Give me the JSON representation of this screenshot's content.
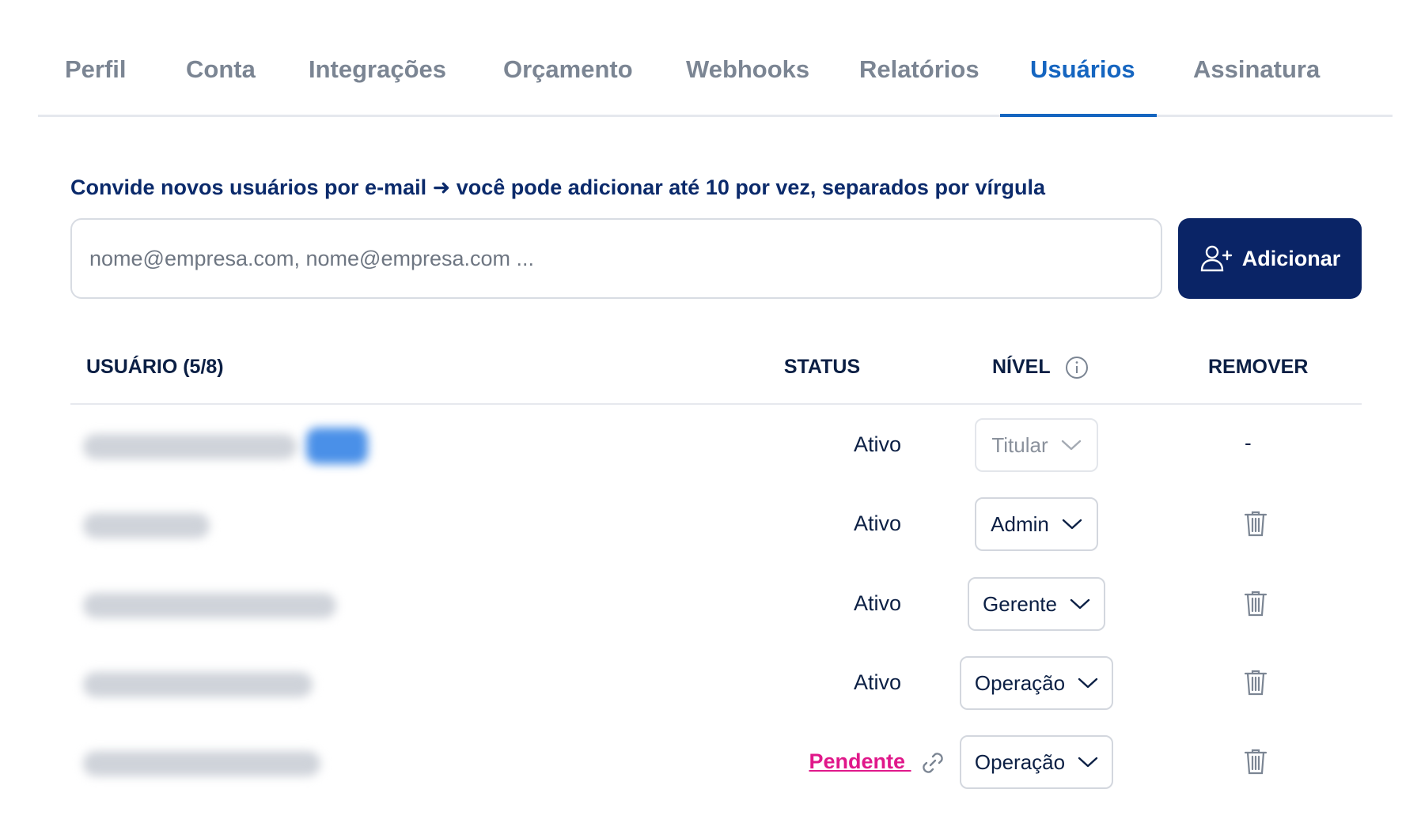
{
  "tabs": [
    {
      "label": "Perfil"
    },
    {
      "label": "Conta"
    },
    {
      "label": "Integrações"
    },
    {
      "label": "Orçamento"
    },
    {
      "label": "Webhooks"
    },
    {
      "label": "Relatórios"
    },
    {
      "label": "Usuários",
      "active": true
    },
    {
      "label": "Assinatura"
    }
  ],
  "invite": {
    "label": "Convide novos usuários por e-mail ➜ você pode adicionar até 10 por vez, separados por vírgula",
    "placeholder": "nome@empresa.com, nome@empresa.com ...",
    "value": "",
    "button_label": "Adicionar"
  },
  "table": {
    "headers": {
      "user": "USUÁRIO (5/8)",
      "status": "STATUS",
      "level": "NÍVEL",
      "remove": "REMOVER"
    },
    "rows": [
      {
        "status": "Ativo",
        "level": "Titular",
        "level_disabled": true,
        "remove": "-"
      },
      {
        "status": "Ativo",
        "level": "Admin",
        "remove_icon": "trash-icon"
      },
      {
        "status": "Ativo",
        "level": "Gerente",
        "remove_icon": "trash-icon"
      },
      {
        "status": "Ativo",
        "level": "Operação",
        "remove_icon": "trash-icon"
      },
      {
        "status": "Pendente",
        "status_icon": "link-icon",
        "level": "Operação",
        "remove_icon": "trash-icon"
      }
    ]
  },
  "colors": {
    "accent": "#1565c0",
    "button_bg": "#0a2466",
    "pending": "#e0188a",
    "tab_inactive": "#7b8593"
  }
}
